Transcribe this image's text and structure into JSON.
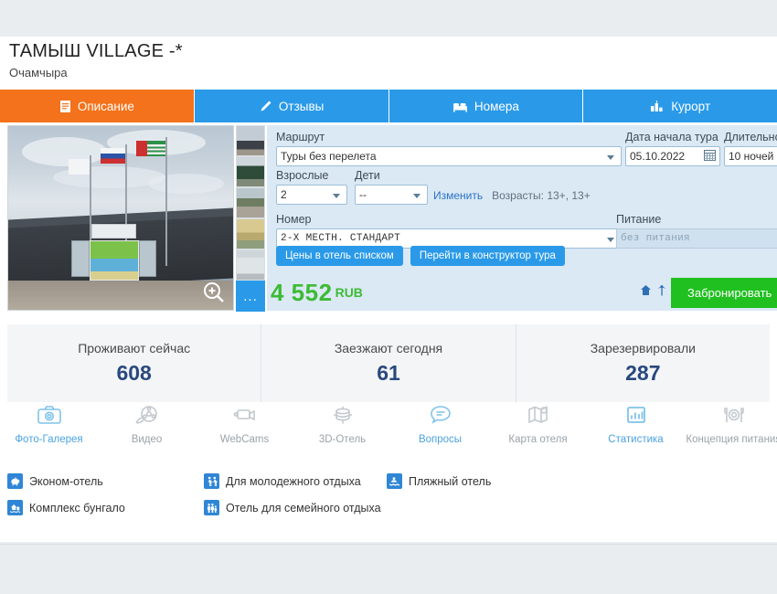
{
  "header": {
    "title": "ТАМЫШ VILLAGE -*",
    "subtitle": "Очамчыра"
  },
  "tabs": [
    {
      "label": "Описание",
      "icon": "document-icon",
      "active": true
    },
    {
      "label": "Отзывы",
      "icon": "pencil-icon",
      "active": false
    },
    {
      "label": "Номера",
      "icon": "bed-icon",
      "active": false
    },
    {
      "label": "Курорт",
      "icon": "resort-icon",
      "active": false
    }
  ],
  "gallery": {
    "more_label": "...",
    "zoom_icon": "magnifier-plus-icon",
    "thumb_count": 5
  },
  "form": {
    "route_label": "Маршрут",
    "route_value": "Туры без перелета",
    "date_label": "Дата начала тура",
    "date_value": "05.10.2022",
    "duration_label": "Длительность",
    "duration_value": "10 ночей",
    "adults_label": "Взрослые",
    "adults_value": "2",
    "kids_label": "Дети",
    "kids_value": "--",
    "change_link": "Изменить",
    "ages_text": "Возрасты: 13+, 13+",
    "room_label": "Номер",
    "room_value": "2-Х МЕСТН. СТАНДАРТ",
    "meal_label": "Питание",
    "meal_value": "без питания",
    "btn_price_list": "Цены в отель списком",
    "btn_constructor": "Перейти в конструктор тура"
  },
  "price": {
    "amount": "4 552",
    "currency": "RUB",
    "book_button": "Забронировать",
    "icons": [
      "home-icon",
      "palm-tree-icon"
    ]
  },
  "stats": [
    {
      "label": "Проживают сейчас",
      "value": "608"
    },
    {
      "label": "Заезжают сегодня",
      "value": "61"
    },
    {
      "label": "Зарезервировали",
      "value": "287"
    }
  ],
  "features": [
    {
      "label": "Фото-Галерея",
      "icon": "camera-icon",
      "enabled": true
    },
    {
      "label": "Видео",
      "icon": "film-reel-icon",
      "enabled": false
    },
    {
      "label": "WebCams",
      "icon": "webcam-icon",
      "enabled": false
    },
    {
      "label": "3D-Отель",
      "icon": "cube-3d-icon",
      "enabled": false
    },
    {
      "label": "Вопросы",
      "icon": "speech-bubble-icon",
      "enabled": true
    },
    {
      "label": "Карта отеля",
      "icon": "map-pin-icon",
      "enabled": false
    },
    {
      "label": "Статистика",
      "icon": "bar-chart-icon",
      "enabled": true
    },
    {
      "label": "Концепция питания",
      "icon": "cutlery-icon",
      "enabled": false
    }
  ],
  "tags": [
    {
      "label": "Эконом-отель",
      "icon": "piggy-bank-icon"
    },
    {
      "label": "Для молодежного отдыха",
      "icon": "dancers-icon"
    },
    {
      "label": "Пляжный отель",
      "icon": "beach-icon"
    },
    {
      "label": "Комплекс бунгало",
      "icon": "bungalow-icon"
    },
    {
      "label": "Отель для семейного отдыха",
      "icon": "family-icon"
    }
  ],
  "colors": {
    "accent_orange": "#f4721b",
    "accent_blue": "#2a9ae8",
    "price_green": "#3dbb35",
    "book_green": "#1fc020",
    "stat_navy": "#29487d",
    "panel_blue": "#dbe9f5"
  }
}
